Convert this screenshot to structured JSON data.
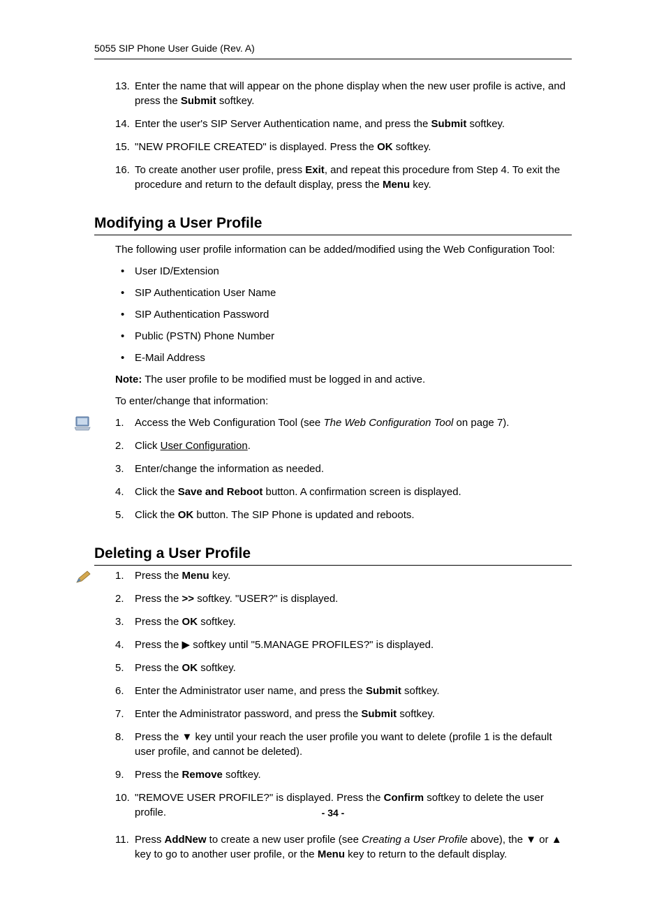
{
  "header": "5055 SIP Phone User Guide (Rev. A)",
  "top_list": {
    "i13": {
      "n": "13.",
      "t1": "Enter the name that will appear on the phone display when the new user profile is active, and press the ",
      "b1": "Submit",
      "t2": " softkey."
    },
    "i14": {
      "n": "14.",
      "t1": "Enter the user's SIP Server Authentication name, and press the ",
      "b1": "Submit",
      "t2": " softkey."
    },
    "i15": {
      "n": "15.",
      "t1": " \"NEW PROFILE CREATED\" is displayed. Press the ",
      "b1": "OK",
      "t2": " softkey."
    },
    "i16": {
      "n": "16.",
      "t1": "To create another user profile, press ",
      "b1": "Exit",
      "t2": ", and repeat this procedure from Step 4. To exit the procedure and return to the default display, press the ",
      "b2": "Menu",
      "t3": " key."
    }
  },
  "h_modify": "Modifying a User Profile",
  "mod_intro": "The following user profile information can be added/modified using the Web Configuration Tool:",
  "mod_bullets": {
    "b1": "User ID/Extension",
    "b2": "SIP Authentication User Name",
    "b3": "SIP Authentication Password",
    "b4": "Public (PSTN) Phone Number",
    "b5": "E-Mail Address"
  },
  "mod_note_label": "Note:",
  "mod_note_text": "  The user profile to be modified must be logged in and active.",
  "mod_to_enter": "To enter/change that information:",
  "mod_steps": {
    "s1": {
      "n": "1.",
      "t1": "Access the Web Configuration Tool (see ",
      "i1": "The Web Configuration Tool",
      "t2": " on page 7)."
    },
    "s2": {
      "n": "2.",
      "t1": "Click ",
      "u1": "User Configuration",
      "t2": "."
    },
    "s3": {
      "n": "3.",
      "t1": "Enter/change the information as needed."
    },
    "s4": {
      "n": "4.",
      "t1": "Click the ",
      "b1": "Save and Reboot",
      "t2": " button. A confirmation screen is displayed."
    },
    "s5": {
      "n": "5.",
      "t1": "Click the ",
      "b1": "OK",
      "t2": " button. The SIP Phone is updated and reboots."
    }
  },
  "h_delete": "Deleting a User Profile",
  "del_steps": {
    "s1": {
      "n": "1.",
      "t1": "Press the ",
      "b1": "Menu",
      "t2": " key."
    },
    "s2": {
      "n": "2.",
      "t1": "Press the ",
      "b1": ">>",
      "t2": " softkey. \"USER?\" is displayed."
    },
    "s3": {
      "n": "3.",
      "t1": "Press the ",
      "b1": "OK",
      "t2": " softkey."
    },
    "s4": {
      "n": "4.",
      "t1": "Press the ",
      "tr": "▶",
      "t2": "  softkey until \"5.MANAGE PROFILES?\" is displayed."
    },
    "s5": {
      "n": "5.",
      "t1": "Press the ",
      "b1": "OK",
      "t2": " softkey."
    },
    "s6": {
      "n": "6.",
      "t1": "Enter the Administrator user name, and press the ",
      "b1": "Submit",
      "t2": " softkey."
    },
    "s7": {
      "n": "7.",
      "t1": "Enter the Administrator password, and press the ",
      "b1": "Submit",
      "t2": " softkey."
    },
    "s8": {
      "n": "8.",
      "t1": "Press the  ",
      "tr": "▼",
      "t2": " key until your reach the user profile you want to delete (profile 1 is the default user profile, and cannot be deleted)."
    },
    "s9": {
      "n": "9.",
      "t1": "Press the ",
      "b1": "Remove",
      "t2": " softkey."
    },
    "s10": {
      "n": "10.",
      "t1": "\"REMOVE USER PROFILE?\" is displayed. Press the ",
      "b1": "Confirm",
      "t2": " softkey to delete the user profile."
    },
    "s11": {
      "n": "11.",
      "t1": "Press ",
      "b1": "AddNew",
      "t2": " to create a new user profile (see ",
      "i1": "Creating a User Profile",
      "t3": " above), the ",
      "tr1": "▼",
      "t4": " or ",
      "tr2": "▲",
      "t5": " key to go to another user profile, or the ",
      "b2": "Menu",
      "t6": " key to return to the default display."
    }
  },
  "page_number": "- 34 -"
}
